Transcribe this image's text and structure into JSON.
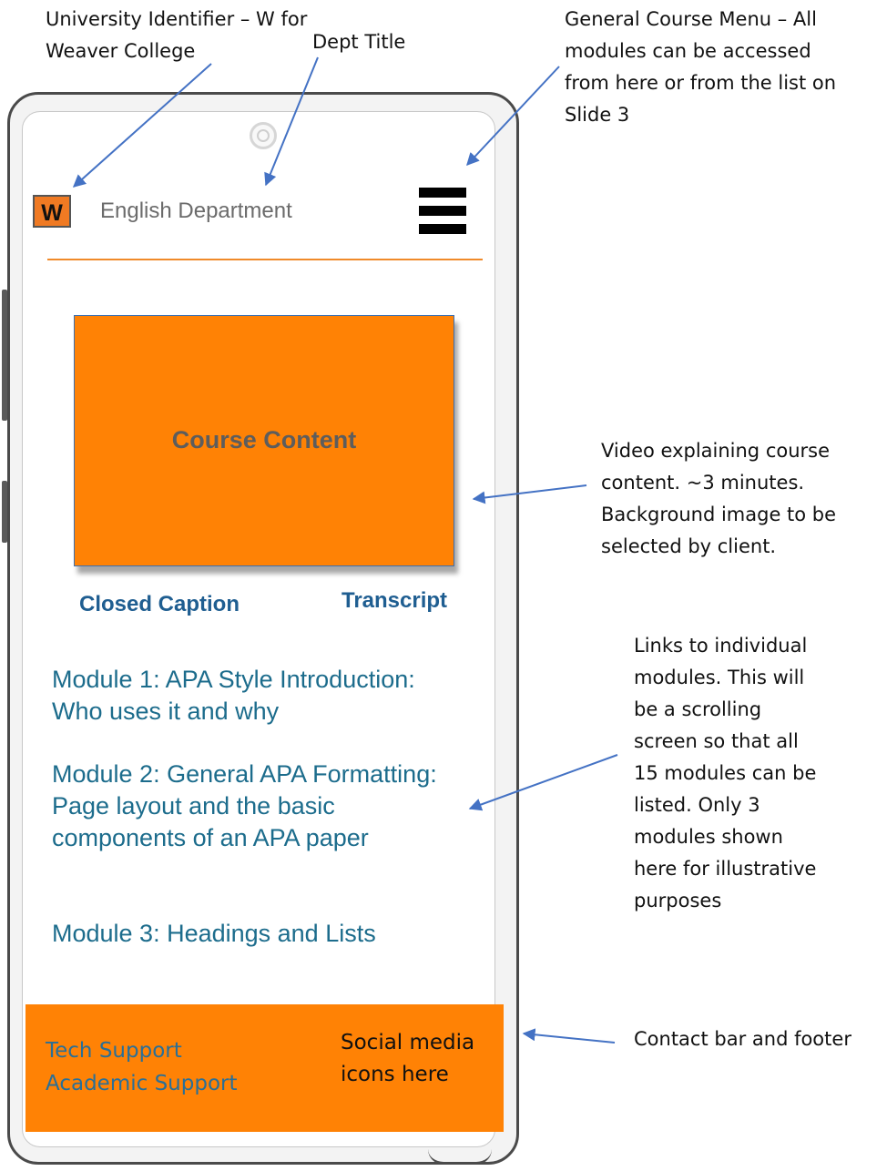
{
  "header": {
    "logo_letter": "W",
    "dept_title": "English Department",
    "menu_icon": "hamburger-menu-icon"
  },
  "video": {
    "title": "Course Content",
    "closed_caption_label": "Closed Caption",
    "transcript_label": "Transcript"
  },
  "modules": [
    {
      "label": "Module 1: APA Style Introduction: Who uses it and why"
    },
    {
      "label": "Module 2: General APA Formatting: Page layout and the basic components of an APA paper"
    },
    {
      "label": "Module 3: Headings and Lists"
    }
  ],
  "footer": {
    "tech_support": "Tech Support",
    "academic_support": "Academic Support",
    "social_note": "Social media icons here"
  },
  "annotations": {
    "university": "University  Identifier – W for Weaver College",
    "dept": "Dept Title",
    "menu": "General Course Menu – All modules can be accessed from here or from the list on Slide 3",
    "video": "Video explaining course content. ~3 minutes. Background image to be selected by client.",
    "modules": "Links to individual modules. This will be a scrolling screen so that all 15 modules can be listed. Only 3 modules shown here for illustrative purposes",
    "footer": "Contact bar and footer"
  },
  "colors": {
    "accent_orange": "#ff8205",
    "link_blue": "#1c6c8c",
    "arrow_blue": "#4472c4"
  }
}
